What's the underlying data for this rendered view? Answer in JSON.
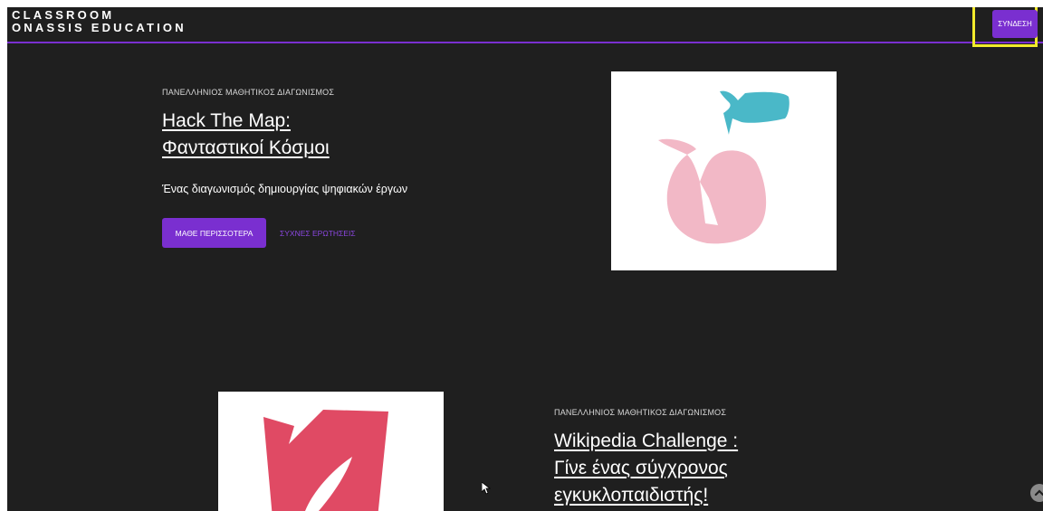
{
  "header": {
    "logo_line1": "CLASSROOM",
    "logo_line2": "ONASSIS EDUCATION",
    "login_label": "ΣΥΝΔΕΣΗ"
  },
  "featured": [
    {
      "eyebrow": "ΠΑΝΕΛΛΗΝΙΟΣ ΜΑΘΗΤΙΚΟΣ ΔΙΑΓΩΝΙΣΜΟΣ",
      "title_line1": "Hack The Map:",
      "title_line2": "Φανταστικοί Κόσμοι",
      "subtitle": "Ένας διαγωνισμός δημιουργίας ψηφιακών έργων",
      "learn_more_label": "ΜΑΘΕ ΠΕΡΙΣΣΟΤΕΡΑ",
      "faq_label": "ΣΥΧΝΕΣ ΕΡΩΤΗΣΕΙΣ",
      "illustration_icon": "apple-fish-illustration"
    },
    {
      "eyebrow": "ΠΑΝΕΛΛΗΝΙΟΣ ΜΑΘΗΤΙΚΟΣ ΔΙΑΓΩΝΙΣΜΟΣ",
      "title_line1": "Wikipedia Challenge :",
      "title_line2": "Γίνε ένας σύγχρονος",
      "title_line3": "εγκυκλοπαιδιστής!",
      "illustration_icon": "leaf-shape-illustration"
    }
  ],
  "colors": {
    "background": "#1f1f1f",
    "accent": "#7a2fd0",
    "highlight": "#f2ea2c",
    "pink": "#f2b8c6",
    "teal": "#4ab8c8",
    "crimson": "#e04a64"
  }
}
